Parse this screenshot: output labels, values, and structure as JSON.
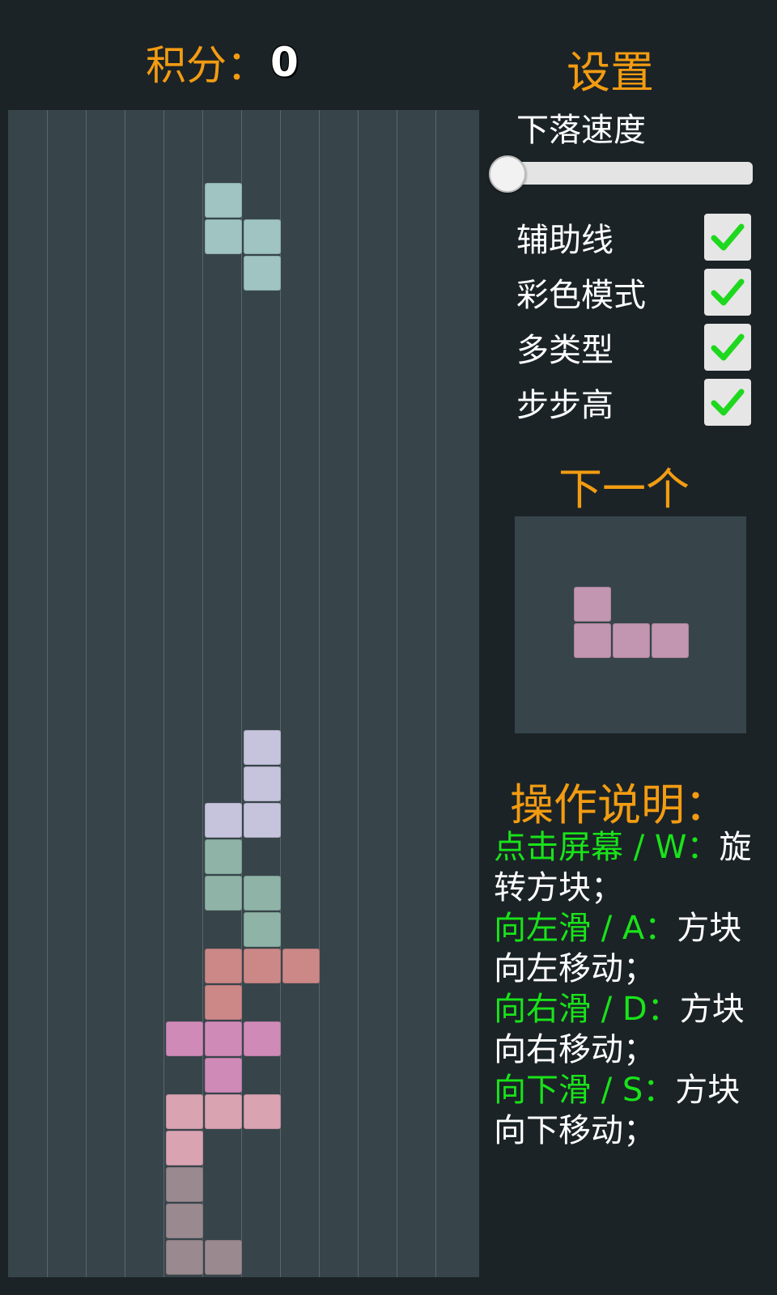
{
  "score": {
    "label": "积分：",
    "value": "0"
  },
  "settings": {
    "title": "设置",
    "speed_label": "下落速度",
    "speed_value": 0,
    "options": [
      {
        "label": "辅助线",
        "checked": true
      },
      {
        "label": "彩色模式",
        "checked": true
      },
      {
        "label": "多类型",
        "checked": true
      },
      {
        "label": "步步高",
        "checked": true
      }
    ]
  },
  "next": {
    "title": "下一个"
  },
  "help": {
    "title": "操作说明：",
    "items": [
      {
        "key": "点击屏幕 / W：",
        "desc": "旋转方块；"
      },
      {
        "key": "向左滑 / A：",
        "desc": "方块向左移动；"
      },
      {
        "key": "向右滑 / D：",
        "desc": "方块向右移动；"
      },
      {
        "key": "向下滑 / S：",
        "desc": "方块向下移动；"
      }
    ]
  },
  "colors": {
    "accent": "#f39c12",
    "key_green": "#19e319",
    "check_green": "#1ed81e"
  }
}
